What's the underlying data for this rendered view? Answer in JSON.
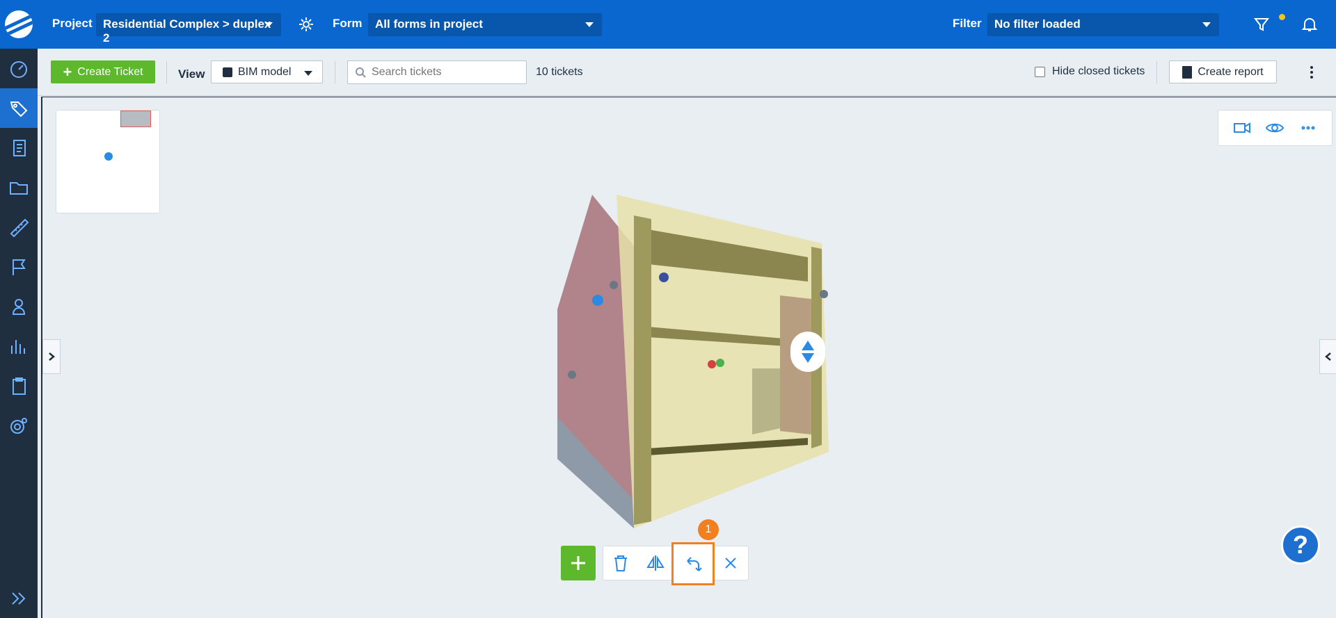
{
  "topbar": {
    "project_label": "Project",
    "project_value": "Residential Complex > duplex 2",
    "form_label": "Form",
    "form_value": "All forms in project",
    "filter_label": "Filter",
    "filter_value": "No filter loaded"
  },
  "toolbar": {
    "create_ticket": "Create Ticket",
    "view_label": "View",
    "view_value": "BIM model",
    "search_placeholder": "Search tickets",
    "ticket_count": "10 tickets",
    "hide_closed": "Hide closed tickets",
    "create_report": "Create report"
  },
  "viewer": {
    "step_badge": "1",
    "help": "?"
  },
  "colors": {
    "brand_blue": "#0a67cf",
    "rail_dark": "#1f2f40",
    "accent_green": "#5db82b",
    "highlight_orange": "#f08020"
  },
  "sidebar": {
    "items": [
      "dashboard-icon",
      "tickets-icon",
      "forms-icon",
      "folder-icon",
      "ruler-icon",
      "flag-icon",
      "user-icon",
      "chart-icon",
      "clipboard-icon",
      "settings-icon"
    ]
  }
}
